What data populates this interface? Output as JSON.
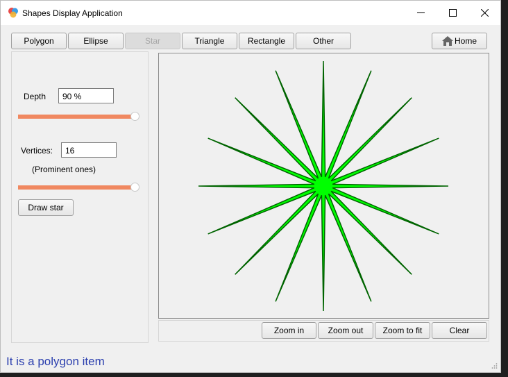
{
  "window": {
    "title": "Shapes Display Application"
  },
  "toolbar": {
    "shape_tabs": [
      {
        "label": "Polygon",
        "enabled": true
      },
      {
        "label": "Ellipse",
        "enabled": true
      },
      {
        "label": "Star",
        "enabled": false
      },
      {
        "label": "Triangle",
        "enabled": true
      },
      {
        "label": "Rectangle",
        "enabled": true
      },
      {
        "label": "Other",
        "enabled": true
      }
    ],
    "home_label": "Home",
    "home_icon": "home-icon"
  },
  "controls": {
    "depth_label": "Depth",
    "depth_value": "90 %",
    "depth_slider_fraction": 1.0,
    "vertices_label": "Vertices:",
    "vertices_value": "16",
    "prominent_note": "(Prominent ones)",
    "vertices_slider_fraction": 1.0,
    "draw_button": "Draw star"
  },
  "canvas": {
    "shape": "star",
    "points": 16,
    "depth_percent": 90,
    "fill_color": "#00ff00",
    "stroke_color": "#006400"
  },
  "view_buttons": {
    "zoom_in": "Zoom in",
    "zoom_out": "Zoom out",
    "zoom_fit": "Zoom to fit",
    "clear": "Clear"
  },
  "status_text": "It is a polygon item",
  "colors": {
    "slider_accent": "#f08860",
    "status_text": "#2b3fae"
  }
}
